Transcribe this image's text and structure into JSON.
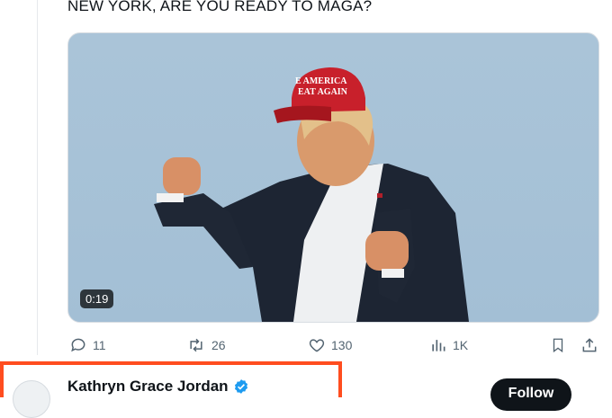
{
  "tweet": {
    "text": "NEW YORK, ARE YOU READY TO MAGA?"
  },
  "media": {
    "duration": "0:19",
    "cap_text_line1": "E AMERICA",
    "cap_text_line2": "EAT AGAIN"
  },
  "actions": {
    "replies": "11",
    "reposts": "26",
    "likes": "130",
    "views": "1K"
  },
  "next_user": {
    "name": "Kathryn Grace Jordan",
    "follow_label": "Follow"
  },
  "colors": {
    "highlight": "#ff4d1f",
    "verified": "#1d9bf0",
    "follow_bg": "#0f1419"
  },
  "icons": [
    "reply-icon",
    "repost-icon",
    "like-icon",
    "views-icon",
    "bookmark-icon",
    "share-icon",
    "verified-icon"
  ]
}
